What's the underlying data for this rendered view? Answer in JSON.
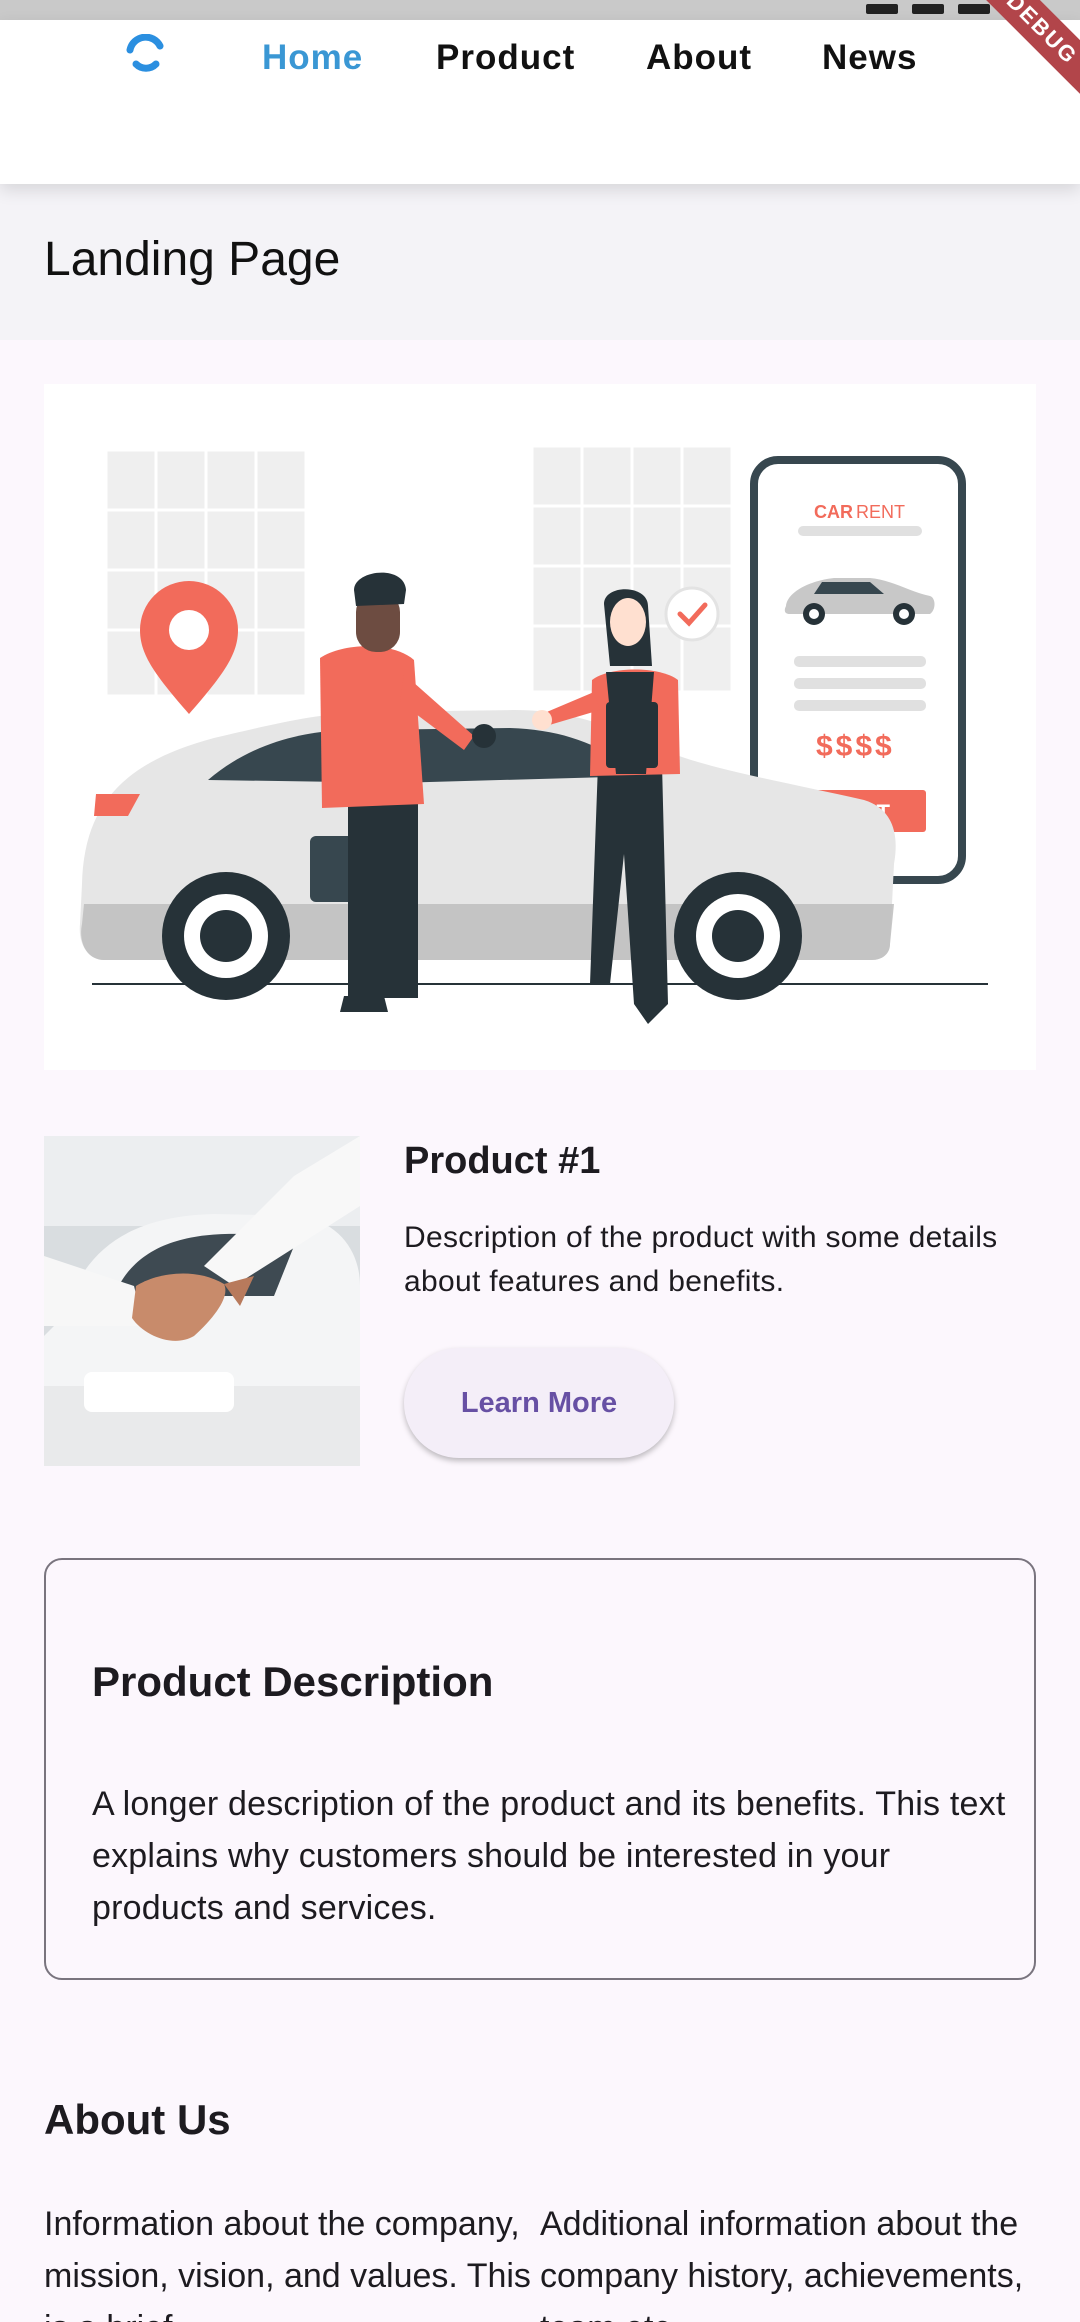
{
  "nav": {
    "items": [
      {
        "label": "Home",
        "active": true
      },
      {
        "label": "Product",
        "active": false
      },
      {
        "label": "About",
        "active": false
      },
      {
        "label": "News",
        "active": false
      }
    ],
    "active_color": "#3a97d4"
  },
  "page": {
    "title": "Landing Page"
  },
  "hero": {
    "phone_brand": "CAR",
    "phone_brand_suffix": "RENT",
    "phone_price": "$$$$",
    "phone_button": "RENT"
  },
  "product": {
    "title": "Product #1",
    "description": "Description of the product with some details about features and benefits.",
    "button": "Learn More"
  },
  "description_card": {
    "title": "Product Description",
    "text": "A longer description of the product and its benefits. This text explains why customers should be interested in your products and services."
  },
  "about": {
    "title": "About Us",
    "col1": "Information about the company, mission, vision, and values. This is a brief",
    "col2": "Additional information about the company history, achievements, team etc."
  },
  "debug_banner": "DEBUG",
  "colors": {
    "accent": "#6750a4",
    "coral": "#f26b5b",
    "dark": "#263238"
  }
}
